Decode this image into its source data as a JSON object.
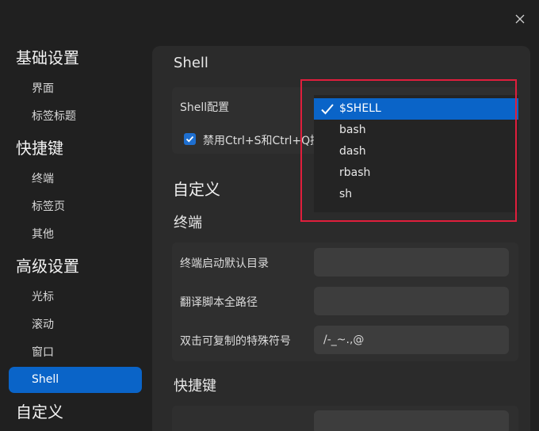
{
  "sidebar": {
    "groups": [
      {
        "label": "基础设置",
        "items": [
          "界面",
          "标签标题"
        ]
      },
      {
        "label": "快捷键",
        "items": [
          "终端",
          "标签页",
          "其他"
        ]
      },
      {
        "label": "高级设置",
        "items": [
          "光标",
          "滚动",
          "窗口",
          "Shell"
        ]
      },
      {
        "label": "自定义",
        "items": []
      }
    ],
    "active_item": "Shell"
  },
  "panel": {
    "title": "Shell",
    "shell_config_label": "Shell配置",
    "disable_ctrl_label": "禁用Ctrl+S和Ctrl+Q控",
    "disable_ctrl_checked": true,
    "custom_heading": "自定义",
    "terminal_heading": "终端",
    "fields": [
      {
        "label": "终端启动默认目录",
        "value": ""
      },
      {
        "label": "翻译脚本全路径",
        "value": ""
      },
      {
        "label": "双击可复制的特殊符号",
        "value": "/-_~.,@"
      }
    ],
    "shortcut_heading": "快捷键"
  },
  "dropdown": {
    "options": [
      "$SHELL",
      "bash",
      "dash",
      "rbash",
      "sh"
    ],
    "selected": "$SHELL"
  },
  "colors": {
    "accent": "#0a64c8",
    "highlight": "#e01e3c"
  },
  "icons": [
    "close-icon",
    "check-icon",
    "checkbox-icon"
  ]
}
